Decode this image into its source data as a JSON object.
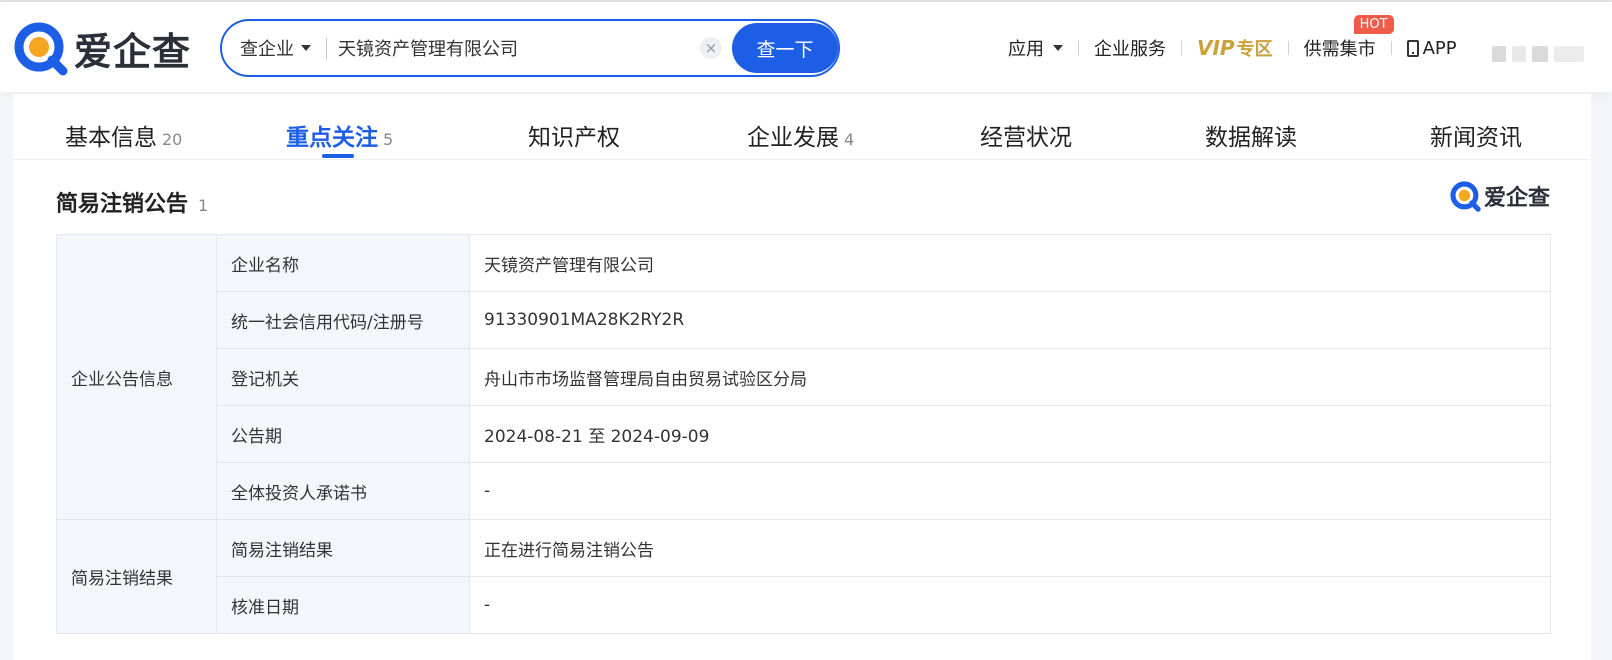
{
  "header": {
    "logo_text": "爱企查",
    "search": {
      "type_label": "查企业",
      "query": "天镜资产管理有限公司",
      "clear_symbol": "×",
      "button_label": "查一下"
    },
    "nav": {
      "apps_label": "应用",
      "enterprise_services_label": "企业服务",
      "vip_label": "VIP",
      "vip_zone_label": "专区",
      "market_label": "供需集市",
      "market_badge": "HOT",
      "app_label": "APP"
    }
  },
  "tabs": [
    {
      "label": "基本信息",
      "count": "20"
    },
    {
      "label": "重点关注",
      "count": "5",
      "active": true
    },
    {
      "label": "知识产权",
      "count": ""
    },
    {
      "label": "企业发展",
      "count": "4"
    },
    {
      "label": "经营状况",
      "count": ""
    },
    {
      "label": "数据解读",
      "count": ""
    },
    {
      "label": "新闻资讯",
      "count": ""
    }
  ],
  "section": {
    "title": "简易注销公告",
    "count": "1",
    "watermark_text": "爱企查"
  },
  "table": {
    "group_1": "企业公告信息",
    "group_2": "简易注销结果",
    "rows": [
      {
        "label": "企业名称",
        "value": "天镜资产管理有限公司"
      },
      {
        "label": "统一社会信用代码/注册号",
        "value": "91330901MA28K2RY2R"
      },
      {
        "label": "登记机关",
        "value": "舟山市市场监督管理局自由贸易试验区分局"
      },
      {
        "label": "公告期",
        "value": "2024-08-21 至 2024-09-09"
      },
      {
        "label": "全体投资人承诺书",
        "value": "-"
      },
      {
        "label": "简易注销结果",
        "value": "正在进行简易注销公告"
      },
      {
        "label": "核准日期",
        "value": "-"
      }
    ]
  },
  "colors": {
    "brand_blue": "#1d5ee6",
    "brand_orange": "#f5a623",
    "vip_gold": "#c9a13b",
    "hot_red": "#f05b4a"
  }
}
